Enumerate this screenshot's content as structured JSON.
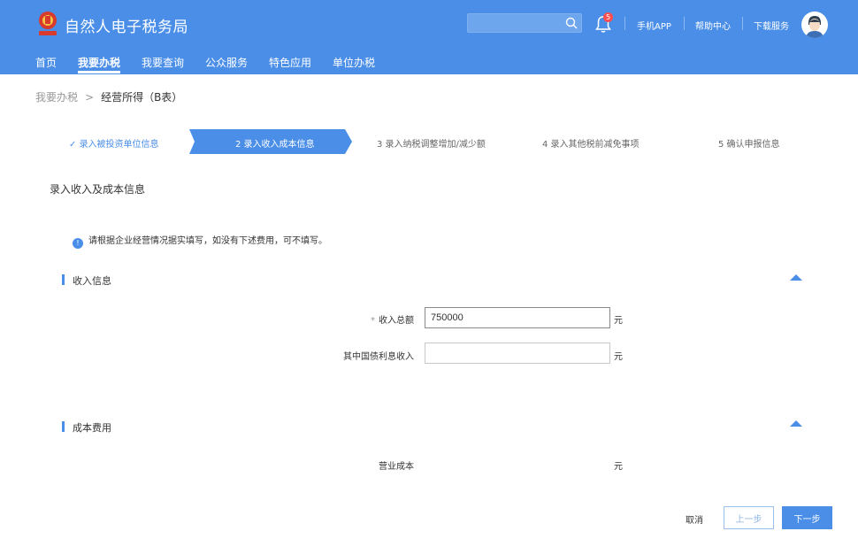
{
  "header": {
    "site_title": "自然人电子税务局",
    "search": {
      "value": "",
      "placeholder": ""
    },
    "notification_count": "5",
    "links": {
      "mobile_app": "手机APP",
      "help_center": "帮助中心",
      "download": "下载服务"
    }
  },
  "nav": {
    "items": [
      {
        "label": "首页"
      },
      {
        "label": "我要办税"
      },
      {
        "label": "我要查询"
      },
      {
        "label": "公众服务"
      },
      {
        "label": "特色应用"
      },
      {
        "label": "单位办税"
      }
    ],
    "active_index": 1
  },
  "breadcrumb": {
    "parent": "我要办税",
    "current": "经营所得（B表）"
  },
  "steps": [
    {
      "label": "录入被投资单位信息",
      "status": "done"
    },
    {
      "label": "2 录入收入成本信息",
      "status": "active"
    },
    {
      "label": "3 录入纳税调整增加/减少额",
      "status": "pending"
    },
    {
      "label": "4 录入其他税前减免事项",
      "status": "pending"
    },
    {
      "label": "5 确认申报信息",
      "status": "pending"
    }
  ],
  "section_title": "录入收入及成本信息",
  "notice": "请根据企业经营情况据实填写，如没有下述费用，可不填写。",
  "income_group": {
    "title": "收入信息",
    "fields": [
      {
        "label": "收入总额",
        "required_mark": "*",
        "value": "750000",
        "unit": "元"
      },
      {
        "label": "其中国债利息收入",
        "value": "",
        "unit": "元"
      }
    ]
  },
  "cost_group": {
    "title": "成本费用",
    "fields": [
      {
        "label": "营业成本",
        "unit": "元"
      }
    ]
  },
  "actions": {
    "cancel": "取消",
    "prev": "上一步",
    "next": "下一步"
  },
  "colors": {
    "primary": "#4a8ee8",
    "badge": "#ff4d4f"
  }
}
